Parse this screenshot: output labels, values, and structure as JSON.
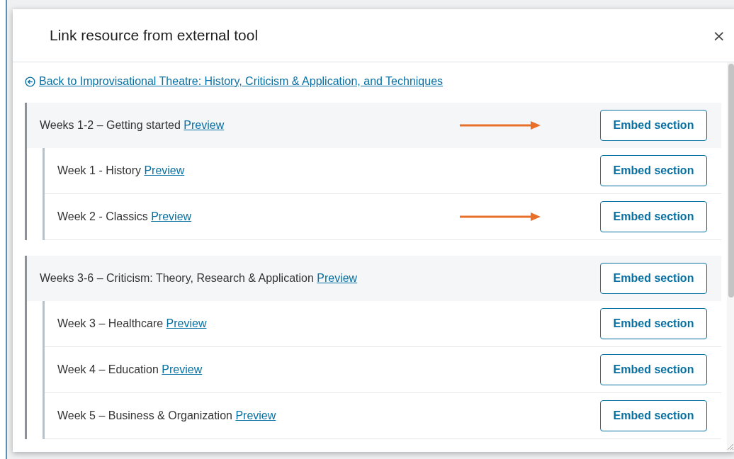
{
  "dialog": {
    "title": "Link resource from external tool",
    "close": "×"
  },
  "back_link": "Back to Improvisational Theatre: History, Criticism & Application, and Techniques",
  "sections": [
    {
      "title": "Weeks 1-2 – Getting started",
      "preview": "Preview",
      "button": "Embed section",
      "annotated": true,
      "children": [
        {
          "title": "Week 1 - History",
          "preview": "Preview",
          "button": "Embed section",
          "annotated": false
        },
        {
          "title": "Week 2 - Classics",
          "preview": "Preview",
          "button": "Embed section",
          "annotated": true
        }
      ]
    },
    {
      "title": "Weeks 3-6 – Criticism: Theory, Research & Application",
      "preview": "Preview",
      "button": "Embed section",
      "annotated": false,
      "children": [
        {
          "title": "Week 3 – Healthcare",
          "preview": "Preview",
          "button": "Embed section",
          "annotated": false
        },
        {
          "title": "Week 4 – Education",
          "preview": "Preview",
          "button": "Embed section",
          "annotated": false
        },
        {
          "title": "Week 5 – Business & Organization",
          "preview": "Preview",
          "button": "Embed section",
          "annotated": false
        }
      ]
    }
  ]
}
